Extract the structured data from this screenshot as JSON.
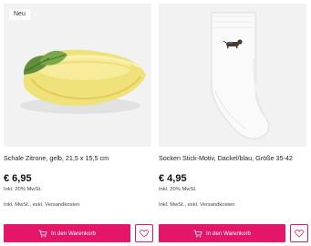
{
  "colors": {
    "accent": "#e3166a",
    "image_bg": "#f2f2f2"
  },
  "products": [
    {
      "badge": "Neu",
      "title": "Schale Zitrone, gelb, 21,5 x 15,5 cm",
      "price": "€ 6,95",
      "vat_note": "Inkl. 20% MwSt.",
      "shipping_note": "Inkl. MwSt., exkl. Versandkosten",
      "cart_label": "In den Warenkorb",
      "cart_icon": "shopping-cart-icon",
      "wishlist_icon": "heart-icon"
    },
    {
      "title": "Socken Stick-Motiv, Dackel/blau, Größe 35-42",
      "price": "€ 4,95",
      "vat_note": "Inkl. 20% MwSt.",
      "shipping_note": "Inkl. MwSt., exkl. Versandkosten",
      "cart_label": "In den Warenkorb",
      "cart_icon": "shopping-cart-icon",
      "wishlist_icon": "heart-icon"
    }
  ]
}
